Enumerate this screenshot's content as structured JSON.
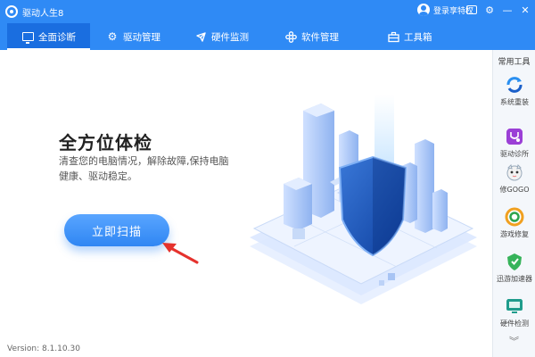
{
  "titlebar": {
    "app_title": "驱动人生8",
    "login_label": "登录享特权"
  },
  "nav": {
    "tabs": [
      {
        "label": "全面诊断",
        "icon": "monitor-icon"
      },
      {
        "label": "驱动管理",
        "icon": "gear-icon"
      },
      {
        "label": "硬件监测",
        "icon": "rocket-icon"
      },
      {
        "label": "软件管理",
        "icon": "apps-icon"
      },
      {
        "label": "工具箱",
        "icon": "toolbox-icon"
      }
    ]
  },
  "main": {
    "headline": "全方位体检",
    "description": "清查您的电脑情况，解除故障,保持电脑健康、驱动稳定。",
    "scan_button": "立即扫描",
    "version": "Version:  8.1.10.30"
  },
  "side": {
    "title": "常用工具",
    "tools": [
      {
        "label": "系统重装"
      },
      {
        "label": "驱动诊所"
      },
      {
        "label": "修GOGO"
      },
      {
        "label": "游戏修复"
      },
      {
        "label": "迅游加速器"
      },
      {
        "label": "硬件检测"
      }
    ]
  },
  "colors": {
    "brand": "#2f8af5",
    "active_tab": "#1a6ee0",
    "arrow": "#e5322d"
  }
}
